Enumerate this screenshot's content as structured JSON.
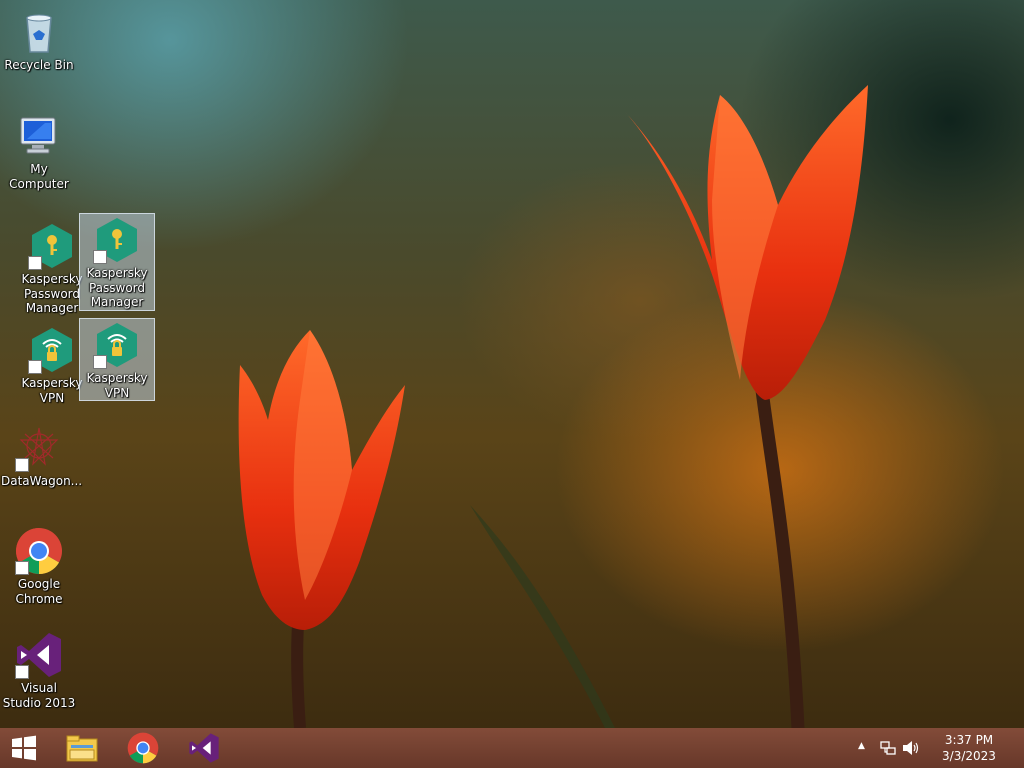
{
  "desktop": {
    "icons": [
      {
        "label": "Recycle Bin"
      },
      {
        "label": "My Computer"
      },
      {
        "label": "Kaspersky Password Manager"
      },
      {
        "label": "Kaspersky Password Manager"
      },
      {
        "label": "Kaspersky VPN"
      },
      {
        "label": "Kaspersky VPN"
      },
      {
        "label": "DataWagon..."
      },
      {
        "label": "Google Chrome"
      },
      {
        "label": "Visual Studio 2013"
      }
    ]
  },
  "taskbar": {
    "pinned": [
      "windows-logo-icon",
      "file-explorer-icon",
      "google-chrome-icon",
      "visual-studio-icon"
    ],
    "tray_icons": [
      "show-hidden-icons-chevron",
      "network-icon",
      "volume-icon"
    ],
    "clock": {
      "time": "3:37 PM",
      "date": "3/3/2023"
    }
  },
  "colors": {
    "kaspersky_green": "#1f9b7c",
    "vs_purple": "#68217a",
    "taskbar": "#6e3823"
  }
}
